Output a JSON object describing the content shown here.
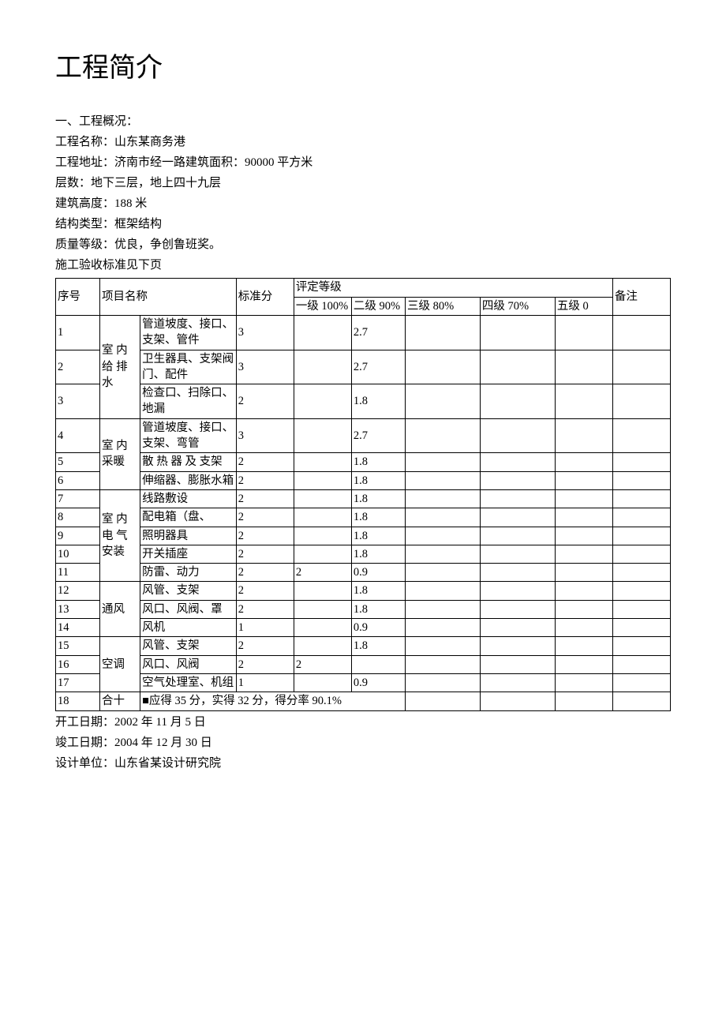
{
  "title": "工程简介",
  "intro": {
    "l1": "一、工程概况：",
    "l2": "工程名称：山东某商务港",
    "l3": "工程地址：济南市经一路建筑面积：90000 平方米",
    "l4": "层数：地下三层，地上四十九层",
    "l5": "建筑高度：188 米",
    "l6": "结构类型：框架结构",
    "l7": "质量等级：优良，争创鲁班奖。",
    "l8": "施工验收标准见下页"
  },
  "header": {
    "seq": "序号",
    "project": "项目名称",
    "std": "标准分",
    "grade": "评定等级",
    "g1": "一级 100%",
    "g2": "二级 90%",
    "g3": "三级 80%",
    "g4": "四级 70%",
    "g5": "五级 0",
    "note": "备注"
  },
  "groups": {
    "g1": "室 内 给 排 水",
    "g2": "室 内 采暖",
    "g3": "室 内 电 气 安装",
    "g4": "通风",
    "g5": "空调",
    "sum": "合十"
  },
  "rows": {
    "r1": {
      "seq": "1",
      "item": "管道坡度、接口、支架、管件",
      "std": "3",
      "c1": "",
      "c2": "2.7"
    },
    "r2": {
      "seq": "2",
      "item": "卫生器具、支架阀门、配件",
      "std": "3",
      "c1": "",
      "c2": "2.7"
    },
    "r3": {
      "seq": "3",
      "item": "检查口、扫除口、地漏",
      "std": "2",
      "c1": "",
      "c2": "1.8"
    },
    "r4": {
      "seq": "4",
      "item": "管道坡度、接口、支架、弯管",
      "std": "3",
      "c1": "",
      "c2": "2.7"
    },
    "r5": {
      "seq": "5",
      "item": "散 热 器 及 支架",
      "std": "2",
      "c1": "",
      "c2": "1.8"
    },
    "r6": {
      "seq": "6",
      "item": "伸缩器、膨胀水箱",
      "std": "2",
      "c1": "",
      "c2": "1.8"
    },
    "r7": {
      "seq": "7",
      "item": "线路敷设",
      "std": "2",
      "c1": "",
      "c2": "1.8"
    },
    "r8": {
      "seq": "8",
      "item": "配电箱（盘、",
      "std": "2",
      "c1": "",
      "c2": "1.8"
    },
    "r9": {
      "seq": "9",
      "item": "照明器具",
      "std": "2",
      "c1": "",
      "c2": "1.8"
    },
    "r10": {
      "seq": "10",
      "item": "开关插座",
      "std": "2",
      "c1": "",
      "c2": "1.8"
    },
    "r11": {
      "seq": "11",
      "item": "防雷、动力",
      "std": "2",
      "c1": "2",
      "c2": "0.9"
    },
    "r12": {
      "seq": "12",
      "item": "风管、支架",
      "std": "2",
      "c1": "",
      "c2": "1.8"
    },
    "r13": {
      "seq": "13",
      "item": "风口、风阀、罩",
      "std": "2",
      "c1": "",
      "c2": "1.8"
    },
    "r14": {
      "seq": "14",
      "item": "风机",
      "std": "1",
      "c1": "",
      "c2": "0.9"
    },
    "r15": {
      "seq": "15",
      "item": "风管、支架",
      "std": "2",
      "c1": "",
      "c2": "1.8"
    },
    "r16": {
      "seq": "16",
      "item": "风口、风阀",
      "std": "2",
      "c1": "2",
      "c2": ""
    },
    "r17": {
      "seq": "17",
      "item": "空气处理室、机组",
      "std": "1",
      "c1": "",
      "c2": "0.9"
    },
    "r18": {
      "seq": "18",
      "summary": "■应得 35 分，实得 32 分，得分率 90.1%"
    }
  },
  "footer": {
    "f1": "开工日期：2002 年 11 月 5 日",
    "f2": "竣工日期：2004 年 12 月 30 日",
    "f3": "设计单位：山东省某设计研究院"
  }
}
